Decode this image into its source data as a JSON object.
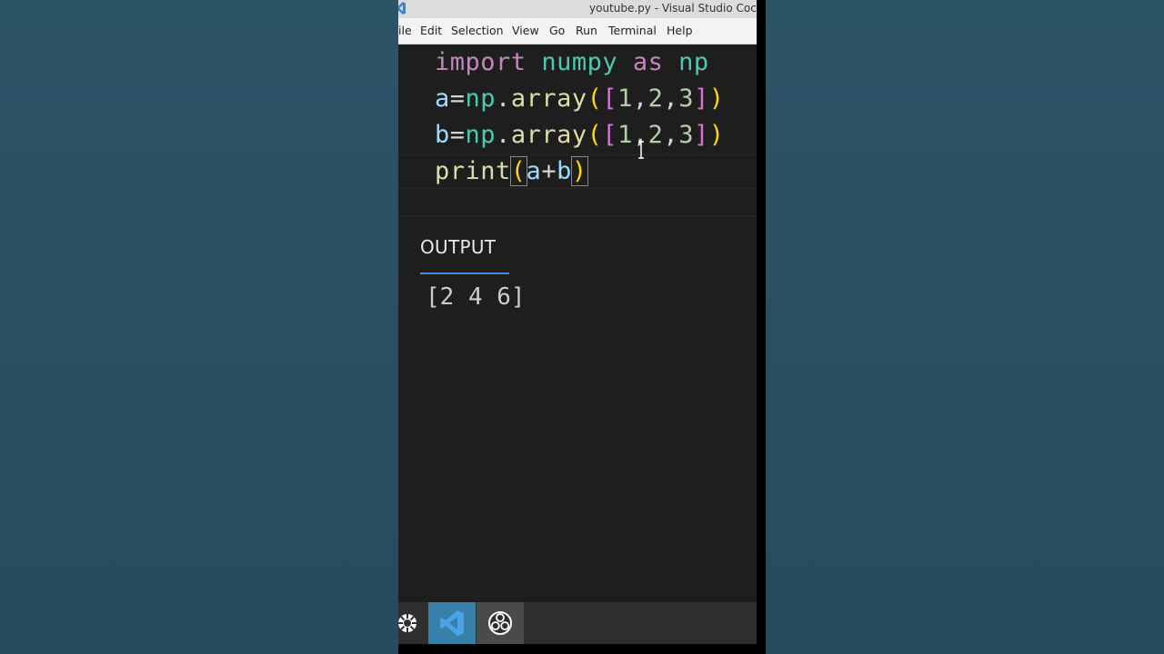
{
  "window": {
    "title": "youtube.py - Visual Studio Coc"
  },
  "menu": {
    "items": [
      {
        "label": "ile"
      },
      {
        "label": "Edit"
      },
      {
        "label": "Selection"
      },
      {
        "label": "View"
      },
      {
        "label": "Go"
      },
      {
        "label": "Run"
      },
      {
        "label": "Terminal"
      },
      {
        "label": "Help"
      }
    ]
  },
  "editor": {
    "lines": [
      "import numpy as np",
      "a=np.array([1,2,3])",
      "b=np.array([1,2,3])",
      "print(a+b)"
    ],
    "tokens": {
      "import": "import",
      "numpy": "numpy",
      "as": "as",
      "np": "np",
      "a": "a",
      "b": "b",
      "eq": "=",
      "dot": ".",
      "array": "array",
      "lparen": "(",
      "rparen": ")",
      "lbrack": "[",
      "rbrack": "]",
      "one": "1",
      "two": "2",
      "three": "3",
      "comma": ",",
      "print": "print",
      "plus": "+"
    }
  },
  "panel": {
    "tab_label": "OUTPUT",
    "output": "[2 4 6]"
  },
  "taskbar": {
    "apps": [
      {
        "icon": "start-menu-icon"
      },
      {
        "icon": "vscode-icon"
      },
      {
        "icon": "obs-icon"
      }
    ]
  },
  "colors": {
    "background": "#2a4f61",
    "editor_bg": "#1e1e1e",
    "keyword": "#c586c0",
    "module": "#4ec9b0",
    "variable": "#9cdcfe",
    "function": "#dcdcaa",
    "number": "#b5cea8",
    "bracket_gold": "#ffd700",
    "bracket_purple": "#da70d6",
    "tab_underline": "#3b8ed8"
  }
}
